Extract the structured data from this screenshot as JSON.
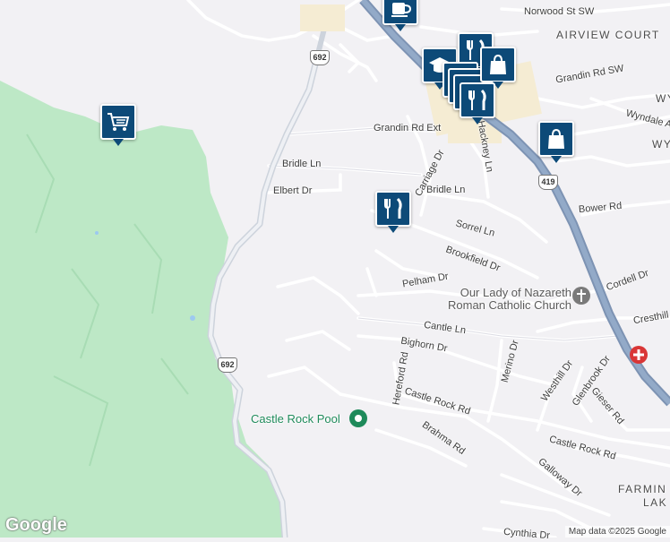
{
  "roads": {
    "norwood": "Norwood St SW",
    "grandin_rd_sw": "Grandin Rd SW",
    "grandin_rd_ext": "Grandin Rd Ext",
    "bridle_ln_west": "Bridle Ln",
    "bridle_ln_east": "Bridle Ln",
    "elbert": "Elbert Dr",
    "carriage": "Carriage Dr",
    "hackney": "Hackney Ln",
    "wyndale": "Wyndale A",
    "bower": "Bower Rd",
    "sorrel": "Sorrel Ln",
    "brookfield": "Brookfield Dr",
    "pelham": "Pelham Dr",
    "cordell": "Cordell Dr",
    "cresthill": "Cresthill",
    "cantle": "Cantle Ln",
    "bighorn": "Bighorn Dr",
    "merino": "Merino Dr",
    "hereford": "Hereford Rd",
    "westhill": "Westhill Dr",
    "glenbrook": "Glenbrook Dr",
    "gieser": "Gieser Rd",
    "castle_rock_rd_1": "Castle Rock Rd",
    "castle_rock_rd_2": "Castle Rock Rd",
    "brahma": "Brahma Rd",
    "galloway": "Galloway Dr",
    "cynthia": "Cynthia Dr"
  },
  "areas": {
    "airview_court": "AIRVIEW COURT",
    "wy_top": "WY",
    "wy_mid": "WY",
    "farmin": "FARMIN",
    "lak": "LAK"
  },
  "shields": {
    "route_692_north": "692",
    "route_692_south": "692",
    "route_419": "419"
  },
  "places": {
    "church_line1": "Our Lady of Nazareth",
    "church_line2": "Roman Catholic Church",
    "pool": "Castle Rock Pool"
  },
  "markers": [
    {
      "kind": "coffee",
      "name": "coffee-marker"
    },
    {
      "kind": "school",
      "name": "school-marker"
    },
    {
      "kind": "restaurant",
      "name": "restaurant-marker"
    },
    {
      "kind": "shopping",
      "name": "shopping-bag-marker"
    },
    {
      "kind": "shopping-cart",
      "name": "shopping-cart-marker"
    },
    {
      "kind": "restaurant",
      "name": "restaurant-marker"
    }
  ],
  "colors": {
    "background": "#f2f1f4",
    "park": "#bde8c6",
    "highway": "#8aa2c0",
    "road": "#ffffff",
    "marker": "#0d4a78",
    "pool_green": "#1e8a5a",
    "hospital_red": "#d93636"
  },
  "branding": {
    "logo": "Google",
    "attribution": "Map data ©2025 Google"
  }
}
